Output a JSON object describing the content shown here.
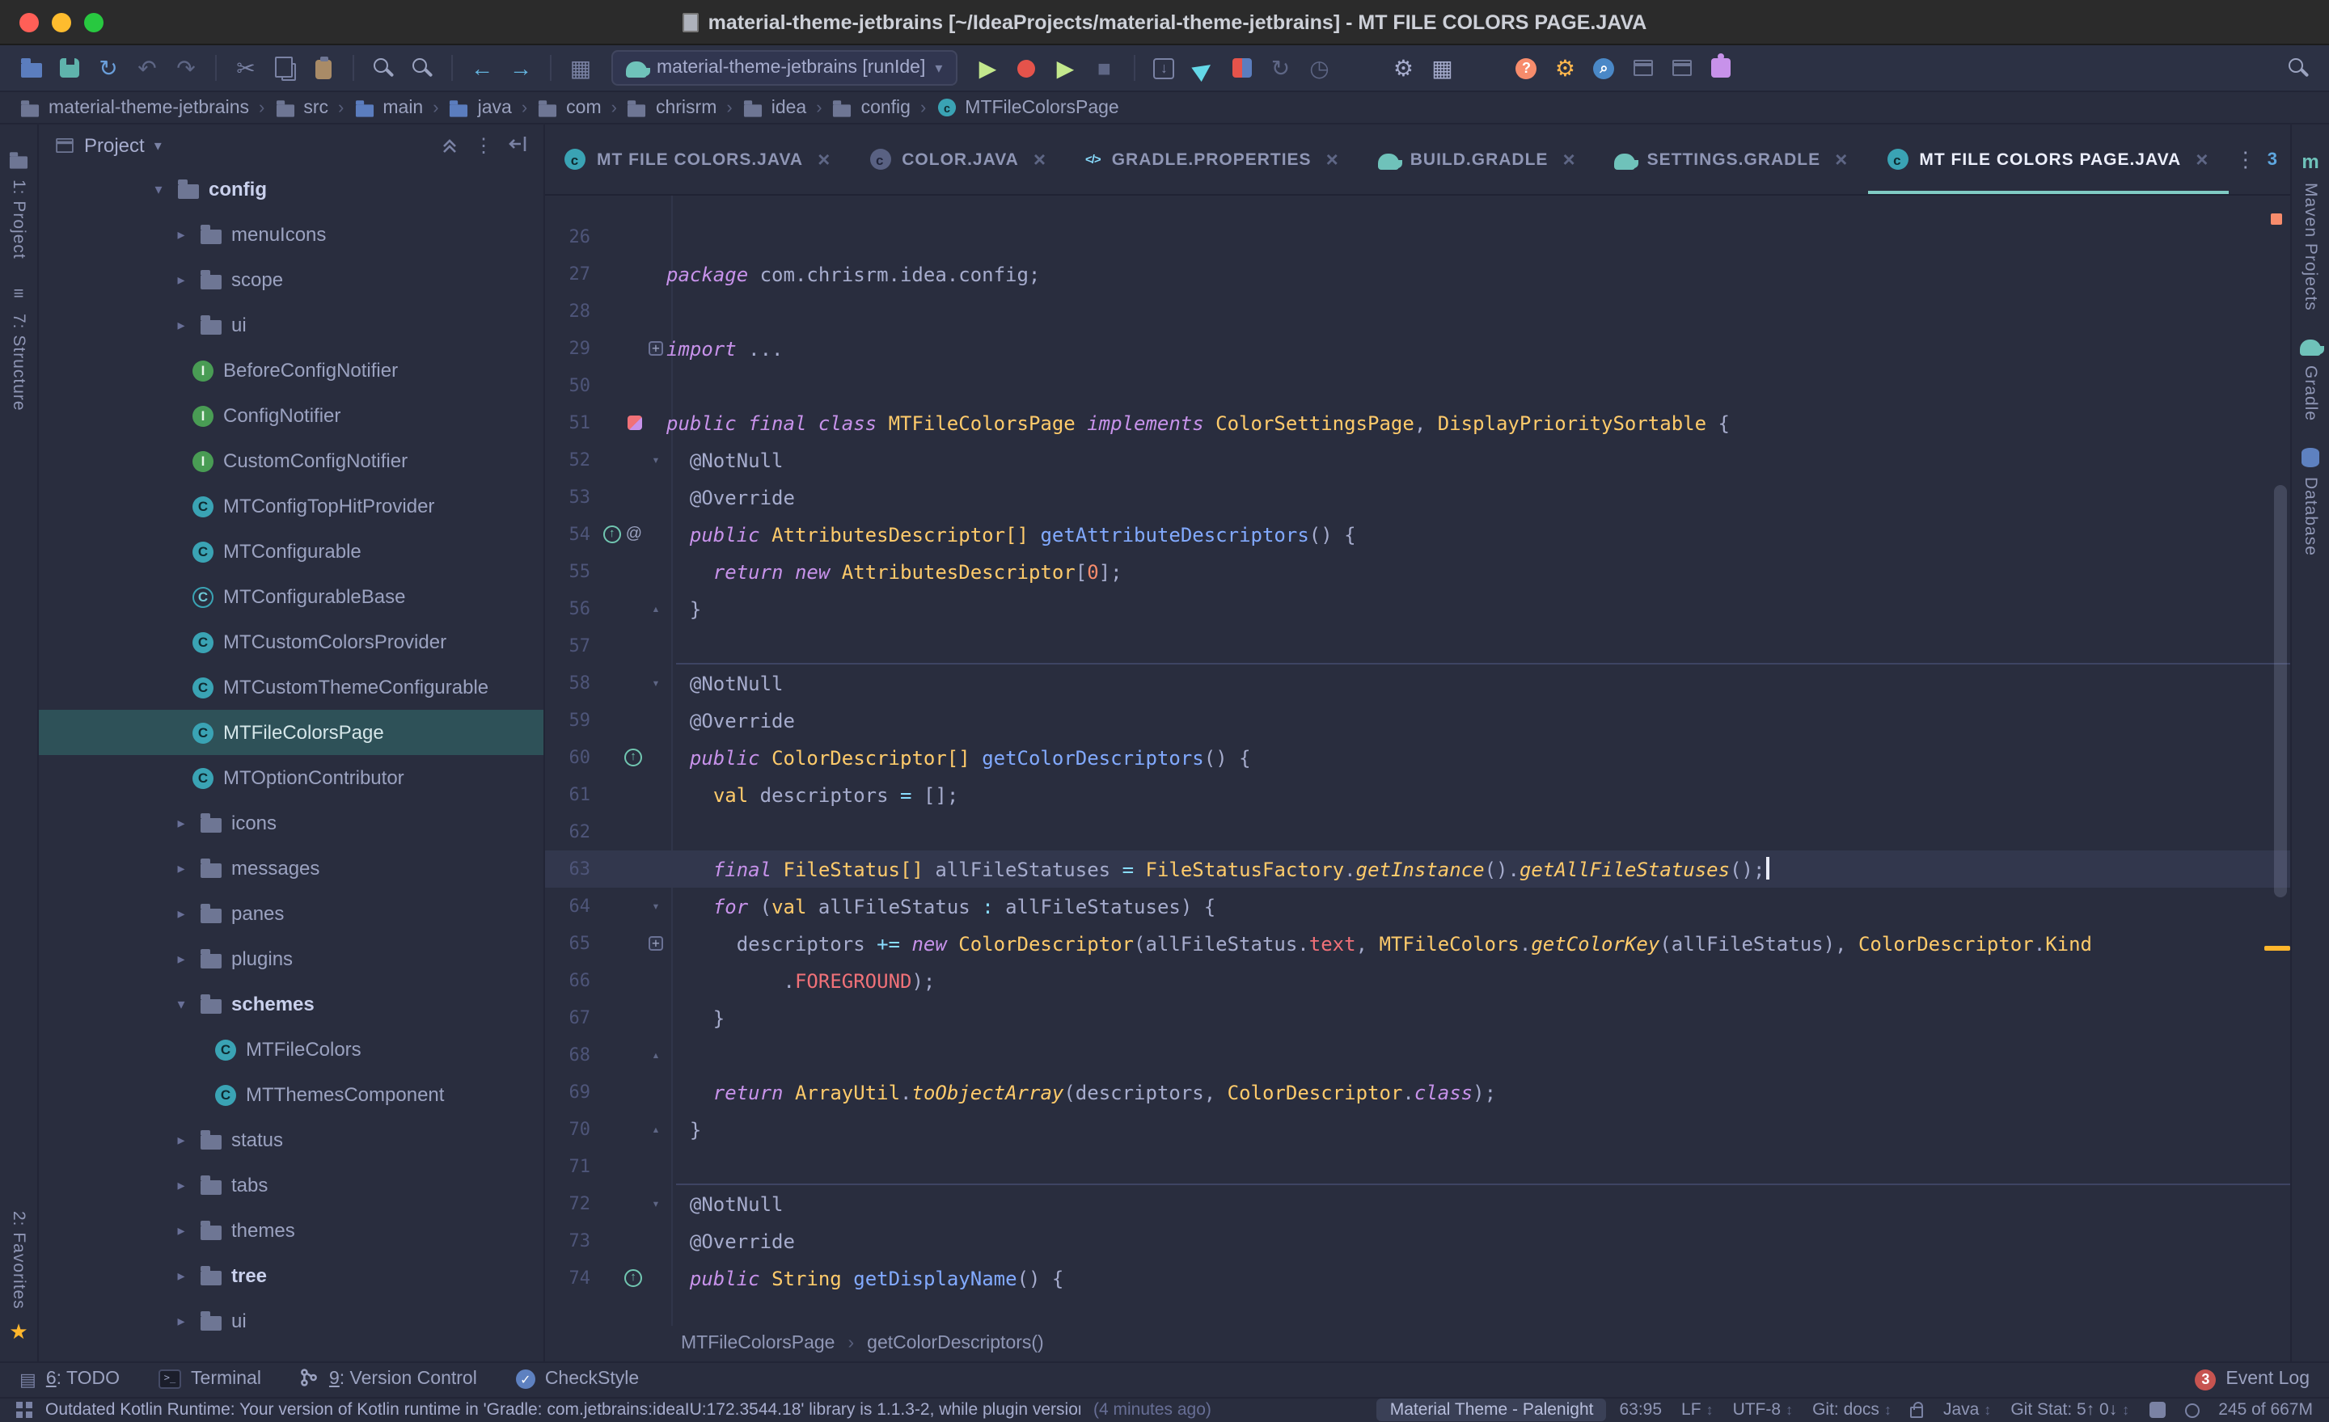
{
  "colors": {
    "bg": "#292D3E",
    "accent": "#80CBC4",
    "selection": "#2E5158",
    "keyword": "#C792EA",
    "type": "#FFCB6B",
    "function": "#82AAFF",
    "field": "#F07178",
    "operator": "#89DDFF"
  },
  "titlebar": {
    "title": "material-theme-jetbrains [~/IdeaProjects/material-theme-jetbrains] - MT FILE COLORS PAGE.JAVA"
  },
  "toolbar": {
    "run_config": "material-theme-jetbrains [runIde]",
    "items": [
      {
        "name": "open-project-icon",
        "kind": "folder",
        "color": "#5B7DBE"
      },
      {
        "name": "save-all-icon",
        "kind": "save"
      },
      {
        "name": "synchronize-icon",
        "kind": "glyph",
        "glyph": "↻",
        "color": "#6A9EDA"
      },
      {
        "name": "undo-icon",
        "kind": "glyph",
        "glyph": "↶",
        "color": "#5E6685"
      },
      {
        "name": "redo-icon",
        "kind": "glyph",
        "glyph": "↷",
        "color": "#5E6685"
      },
      {
        "name": "sep"
      },
      {
        "name": "cut-icon",
        "kind": "glyph",
        "glyph": "✂",
        "color": "#7A82A4"
      },
      {
        "name": "copy-icon",
        "kind": "copy"
      },
      {
        "name": "paste-icon",
        "kind": "paste"
      },
      {
        "name": "sep"
      },
      {
        "name": "find-icon",
        "kind": "mag",
        "color": "#9BA3C0"
      },
      {
        "name": "replace-icon",
        "kind": "mag",
        "color": "#9BA3C0"
      },
      {
        "name": "sep"
      },
      {
        "name": "back-icon",
        "kind": "glyph",
        "glyph": "←",
        "color": "#64B5E0"
      },
      {
        "name": "forward-icon",
        "kind": "glyph",
        "glyph": "→",
        "color": "#64B5E0"
      },
      {
        "name": "sep"
      },
      {
        "name": "grid-icon",
        "kind": "glyph",
        "glyph": "▦",
        "color": "#7A82A4"
      },
      {
        "name": "run-config"
      },
      {
        "name": "run-icon",
        "kind": "glyph",
        "glyph": "▶",
        "color": "#C3E88D"
      },
      {
        "name": "debug-icon",
        "kind": "bug"
      },
      {
        "name": "run-coverage-icon",
        "kind": "glyph",
        "glyph": "▶",
        "color": "#C3E88D"
      },
      {
        "name": "stop-icon",
        "kind": "glyph",
        "glyph": "■",
        "color": "#5E6685"
      },
      {
        "name": "sep"
      },
      {
        "name": "import-icon",
        "kind": "boxarrow",
        "glyph": "↓"
      },
      {
        "name": "deploy-icon",
        "kind": "glyph",
        "glyph": "▶",
        "color": "#64D8E8",
        "rot": -35
      },
      {
        "name": "attach-debugger-icon",
        "kind": "attach"
      },
      {
        "name": "rerun-icon",
        "kind": "glyph",
        "glyph": "↻",
        "color": "#5E6685"
      },
      {
        "name": "history-icon",
        "kind": "glyph",
        "glyph": "◷",
        "color": "#5E6685"
      },
      {
        "name": "gap"
      },
      {
        "name": "settings-icon",
        "kind": "glyph",
        "glyph": "⚙",
        "color": "#A6ACCD"
      },
      {
        "name": "view-mode-icon",
        "kind": "glyph",
        "glyph": "▦",
        "color": "#A6ACCD"
      },
      {
        "name": "gap"
      },
      {
        "name": "help-icon",
        "kind": "badge",
        "glyph": "?",
        "color": "#F78C6C"
      },
      {
        "name": "ide-settings-icon",
        "kind": "glyph",
        "glyph": "⚙",
        "color": "#FFB74D"
      },
      {
        "name": "search-everywhere-icon",
        "kind": "badge",
        "glyph": "⌕",
        "color": "#4A88C7"
      },
      {
        "name": "layout-editor-icon",
        "kind": "win"
      },
      {
        "name": "layout-split-icon",
        "kind": "win"
      },
      {
        "name": "plugin-icon",
        "kind": "puzzle"
      },
      {
        "name": "flex"
      },
      {
        "name": "search-icon",
        "kind": "mag",
        "color": "#9BA3C0"
      }
    ]
  },
  "breadcrumbs": [
    {
      "label": "material-theme-jetbrains",
      "icon": "folder"
    },
    {
      "label": "src",
      "icon": "folder"
    },
    {
      "label": "main",
      "icon": "folder-src"
    },
    {
      "label": "java",
      "icon": "folder-src"
    },
    {
      "label": "com",
      "icon": "folder"
    },
    {
      "label": "chrisrm",
      "icon": "folder"
    },
    {
      "label": "idea",
      "icon": "folder"
    },
    {
      "label": "config",
      "icon": "folder"
    },
    {
      "label": "MTFileColorsPage",
      "icon": "class"
    }
  ],
  "left_strip": {
    "top": [
      {
        "label": "1: Project",
        "icon": "project"
      },
      {
        "label": "7: Structure",
        "icon": "structure"
      }
    ],
    "bottom": [
      {
        "label": "2: Favorites",
        "icon": "star"
      }
    ]
  },
  "right_strip": [
    {
      "label": "Maven Projects",
      "icon": "maven"
    },
    {
      "label": "Gradle",
      "icon": "gradle"
    },
    {
      "label": "Database",
      "icon": "database"
    }
  ],
  "project": {
    "title": "Project",
    "tree": [
      {
        "label": "config",
        "type": "folder",
        "depth": 0,
        "state": "expanded",
        "bold": true
      },
      {
        "label": "menuIcons",
        "type": "folder",
        "depth": 1,
        "state": "collapsed"
      },
      {
        "label": "scope",
        "type": "folder",
        "depth": 1,
        "state": "collapsed"
      },
      {
        "label": "ui",
        "type": "folder",
        "depth": 1,
        "state": "collapsed"
      },
      {
        "label": "BeforeConfigNotifier",
        "type": "interface",
        "depth": 1
      },
      {
        "label": "ConfigNotifier",
        "type": "interface",
        "depth": 1
      },
      {
        "label": "CustomConfigNotifier",
        "type": "interface",
        "depth": 1
      },
      {
        "label": "MTConfigTopHitProvider",
        "type": "class",
        "depth": 1
      },
      {
        "label": "MTConfigurable",
        "type": "class",
        "depth": 1
      },
      {
        "label": "MTConfigurableBase",
        "type": "abstract",
        "depth": 1
      },
      {
        "label": "MTCustomColorsProvider",
        "type": "class",
        "depth": 1
      },
      {
        "label": "MTCustomThemeConfigurable",
        "type": "class",
        "depth": 1
      },
      {
        "label": "MTFileColorsPage",
        "type": "class",
        "depth": 1,
        "selected": true
      },
      {
        "label": "MTOptionContributor",
        "type": "class",
        "depth": 1
      },
      {
        "label": "icons",
        "type": "folder",
        "depth": 1,
        "state": "collapsed"
      },
      {
        "label": "messages",
        "type": "folder",
        "depth": 1,
        "state": "collapsed"
      },
      {
        "label": "panes",
        "type": "folder",
        "depth": 1,
        "state": "collapsed"
      },
      {
        "label": "plugins",
        "type": "folder",
        "depth": 1,
        "state": "collapsed"
      },
      {
        "label": "schemes",
        "type": "folder",
        "depth": 1,
        "state": "expanded",
        "bold": true
      },
      {
        "label": "MTFileColors",
        "type": "class",
        "depth": 2
      },
      {
        "label": "MTThemesComponent",
        "type": "class",
        "depth": 2
      },
      {
        "label": "status",
        "type": "folder",
        "depth": 1,
        "state": "collapsed"
      },
      {
        "label": "tabs",
        "type": "folder",
        "depth": 1,
        "state": "collapsed"
      },
      {
        "label": "themes",
        "type": "folder",
        "depth": 1,
        "state": "collapsed"
      },
      {
        "label": "tree",
        "type": "folder",
        "depth": 1,
        "state": "collapsed",
        "bold": true
      },
      {
        "label": "ui",
        "type": "folder",
        "depth": 1,
        "state": "collapsed"
      }
    ]
  },
  "tabs": [
    {
      "label": "MT FILE COLORS.JAVA",
      "icon": "class"
    },
    {
      "label": "COLOR.JAVA",
      "icon": "class-dim"
    },
    {
      "label": "GRADLE.PROPERTIES",
      "icon": "properties"
    },
    {
      "label": "BUILD.GRADLE",
      "icon": "gradle"
    },
    {
      "label": "SETTINGS.GRADLE",
      "icon": "gradle"
    },
    {
      "label": "MT FILE COLORS PAGE.JAVA",
      "icon": "class",
      "active": true
    }
  ],
  "hidden_tabs": "3",
  "editor": {
    "lines": [
      {
        "n": "26",
        "s": []
      },
      {
        "n": "27",
        "s": [
          [
            "k",
            "package "
          ],
          [
            "p",
            "com.chrisrm.idea.config;"
          ]
        ]
      },
      {
        "n": "28",
        "s": []
      },
      {
        "n": "29",
        "fold": "+",
        "s": [
          [
            "k",
            "import "
          ],
          [
            "p",
            "..."
          ]
        ]
      },
      {
        "n": "50",
        "s": []
      },
      {
        "n": "51",
        "g": "class",
        "s": [
          [
            "k",
            "public final class "
          ],
          [
            "t",
            "MTFileColorsPage"
          ],
          [
            "k",
            " implements "
          ],
          [
            "t",
            "ColorSettingsPage"
          ],
          [
            "p",
            ", "
          ],
          [
            "t",
            "DisplayPrioritySortable"
          ],
          [
            "p",
            " {"
          ]
        ]
      },
      {
        "n": "52",
        "fold": "v",
        "s": [
          [
            "p",
            "  @NotNull"
          ]
        ]
      },
      {
        "n": "53",
        "s": [
          [
            "p",
            "  @Override"
          ]
        ]
      },
      {
        "n": "54",
        "g": "override@",
        "s": [
          [
            "k",
            "  public "
          ],
          [
            "t",
            "AttributesDescriptor[]"
          ],
          [
            "p",
            " "
          ],
          [
            "f",
            "getAttributeDescriptors"
          ],
          [
            "p",
            "() {"
          ]
        ]
      },
      {
        "n": "55",
        "s": [
          [
            "k",
            "    return new "
          ],
          [
            "t",
            "AttributesDescriptor"
          ],
          [
            "p",
            "["
          ],
          [
            "num",
            "0"
          ],
          [
            "p",
            "];"
          ]
        ]
      },
      {
        "n": "56",
        "fold": "^",
        "s": [
          [
            "p",
            "  }"
          ]
        ]
      },
      {
        "n": "57",
        "s": []
      },
      {
        "n": "58",
        "sep": true,
        "fold": "v",
        "s": [
          [
            "p",
            "  @NotNull"
          ]
        ]
      },
      {
        "n": "59",
        "s": [
          [
            "p",
            "  @Override"
          ]
        ]
      },
      {
        "n": "60",
        "g": "override",
        "s": [
          [
            "k",
            "  public "
          ],
          [
            "t",
            "ColorDescriptor[]"
          ],
          [
            "p",
            " "
          ],
          [
            "f",
            "getColorDescriptors"
          ],
          [
            "p",
            "() {"
          ]
        ]
      },
      {
        "n": "61",
        "s": [
          [
            "p",
            "    "
          ],
          [
            "t",
            "val"
          ],
          [
            "p",
            " descriptors "
          ],
          [
            "o",
            "="
          ],
          [
            "p",
            " [];"
          ]
        ]
      },
      {
        "n": "62",
        "s": []
      },
      {
        "n": "63",
        "cur": true,
        "s": [
          [
            "k",
            "    final "
          ],
          [
            "t",
            "FileStatus[]"
          ],
          [
            "p",
            " allFileStatuses "
          ],
          [
            "o",
            "="
          ],
          [
            "p",
            " "
          ],
          [
            "t",
            "FileStatusFactory"
          ],
          [
            "p",
            "."
          ],
          [
            "m",
            "getInstance"
          ],
          [
            "p",
            "()."
          ],
          [
            "m",
            "getAllFileStatuses"
          ],
          [
            "p",
            "();"
          ]
        ]
      },
      {
        "n": "64",
        "fold": "v",
        "s": [
          [
            "k",
            "    for "
          ],
          [
            "p",
            "("
          ],
          [
            "t",
            "val"
          ],
          [
            "p",
            " allFileStatus "
          ],
          [
            "o",
            ":"
          ],
          [
            "p",
            " allFileStatuses) {"
          ]
        ]
      },
      {
        "n": "65",
        "fold": "+",
        "s": [
          [
            "p",
            "      descriptors "
          ],
          [
            "o",
            "+="
          ],
          [
            "k",
            " new "
          ],
          [
            "t",
            "ColorDescriptor"
          ],
          [
            "p",
            "(allFileStatus."
          ],
          [
            "d",
            "text"
          ],
          [
            "p",
            ", "
          ],
          [
            "t",
            "MTFileColors"
          ],
          [
            "p",
            "."
          ],
          [
            "m",
            "getColorKey"
          ],
          [
            "p",
            "(allFileStatus), "
          ],
          [
            "t",
            "ColorDescriptor"
          ],
          [
            "p",
            "."
          ],
          [
            "t",
            "Kind"
          ]
        ]
      },
      {
        "n": "66",
        "s": [
          [
            "p",
            "          ."
          ],
          [
            "d",
            "FOREGROUND"
          ],
          [
            "p",
            ");"
          ]
        ]
      },
      {
        "n": "67",
        "s": [
          [
            "p",
            "    }"
          ]
        ]
      },
      {
        "n": "68",
        "fold": "^",
        "s": []
      },
      {
        "n": "69",
        "s": [
          [
            "k",
            "    return "
          ],
          [
            "t",
            "ArrayUtil"
          ],
          [
            "p",
            "."
          ],
          [
            "m",
            "toObjectArray"
          ],
          [
            "p",
            "(descriptors, "
          ],
          [
            "t",
            "ColorDescriptor"
          ],
          [
            "p",
            "."
          ],
          [
            "k",
            "class"
          ],
          [
            "p",
            ");"
          ]
        ]
      },
      {
        "n": "70",
        "fold": "^",
        "s": [
          [
            "p",
            "  }"
          ]
        ]
      },
      {
        "n": "71",
        "s": []
      },
      {
        "n": "72",
        "sep": true,
        "fold": "v",
        "s": [
          [
            "p",
            "  @NotNull"
          ]
        ]
      },
      {
        "n": "73",
        "s": [
          [
            "p",
            "  @Override"
          ]
        ]
      },
      {
        "n": "74",
        "g": "override",
        "s": [
          [
            "k",
            "  public "
          ],
          [
            "t",
            "String"
          ],
          [
            "p",
            " "
          ],
          [
            "f",
            "getDisplayName"
          ],
          [
            "p",
            "() {"
          ]
        ]
      }
    ],
    "breadcrumb": [
      "MTFileColorsPage",
      "getColorDescriptors()"
    ]
  },
  "bottom_bar": {
    "left": [
      {
        "label": "6: TODO",
        "u": "6",
        "icon": "todo"
      },
      {
        "label": "Terminal",
        "icon": "terminal"
      },
      {
        "label": "9: Version Control",
        "u": "9",
        "icon": "vcs"
      },
      {
        "label": "CheckStyle",
        "icon": "checkstyle"
      }
    ],
    "right": [
      {
        "label": "Event Log",
        "badge": "3"
      }
    ]
  },
  "status_bar": {
    "message": "Outdated Kotlin Runtime: Your version of Kotlin runtime in 'Gradle: com.jetbrains:ideaIU:172.3544.18' library is 1.1.3-2, while plugin version is ...",
    "time": "(4 minutes ago)",
    "theme": "Material Theme - Palenight",
    "items": [
      {
        "name": "caret-position",
        "label": "63:95"
      },
      {
        "name": "line-ending",
        "label": "LF",
        "chev": true
      },
      {
        "name": "encoding",
        "label": "UTF-8",
        "chev": true
      },
      {
        "name": "git-branch",
        "label": "Git: docs",
        "chev": true
      },
      {
        "name": "readonly-lock",
        "icon": "lock"
      },
      {
        "name": "language",
        "label": "Java",
        "chev": true
      },
      {
        "name": "git-stat",
        "label": "Git Stat: 5↑ 0↓",
        "chev": true
      },
      {
        "name": "inspections-profile",
        "icon": "hector"
      },
      {
        "name": "background-tasks",
        "icon": "circle"
      },
      {
        "name": "memory-indicator",
        "label": "245 of 667M"
      }
    ]
  }
}
